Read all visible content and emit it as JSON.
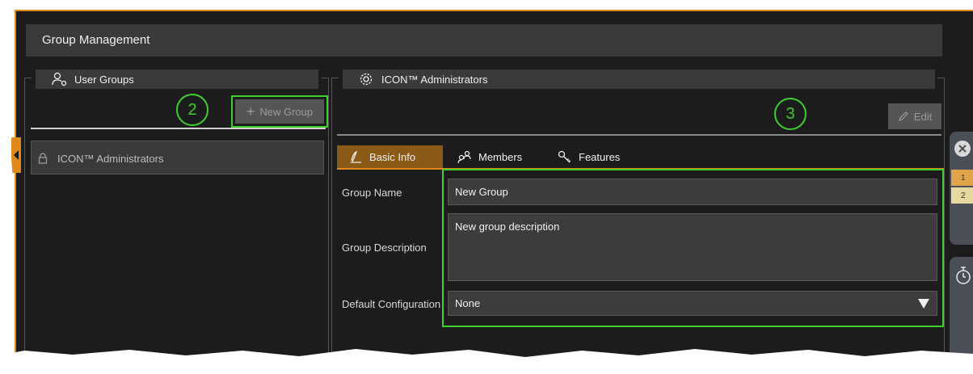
{
  "app": {
    "title": "Group Management"
  },
  "left_panel": {
    "title": "User Groups",
    "new_group_label": "New Group",
    "items": [
      {
        "label": "ICON™ Administrators"
      }
    ]
  },
  "right_panel": {
    "title": "ICON™ Administrators",
    "edit_label": "Edit",
    "tabs": [
      {
        "label": "Basic Info",
        "active": true
      },
      {
        "label": "Members",
        "active": false
      },
      {
        "label": "Features",
        "active": false
      }
    ],
    "form": {
      "group_name_label": "Group Name",
      "group_name_value": "New Group",
      "group_description_label": "Group Description",
      "group_description_value": "New group description",
      "default_config_label": "Default Configuration",
      "default_config_value": "None"
    }
  },
  "annotations": {
    "step_2": "2",
    "step_3": "3"
  },
  "side_panel": {
    "tab_1": "1",
    "tab_2": "2"
  },
  "colors": {
    "accent_orange": "#e0891a",
    "highlight_green": "#3ecf2e",
    "background": "#1c1c1c",
    "panel_header": "#3a3a3a"
  },
  "icons": [
    "user-group-icon",
    "gear-icon",
    "plus-icon",
    "pencil-icon",
    "lock-icon",
    "pen-icon",
    "members-icon",
    "key-icon",
    "dropdown-arrow-icon",
    "close-icon",
    "stopwatch-icon",
    "collapse-arrow-icon"
  ]
}
